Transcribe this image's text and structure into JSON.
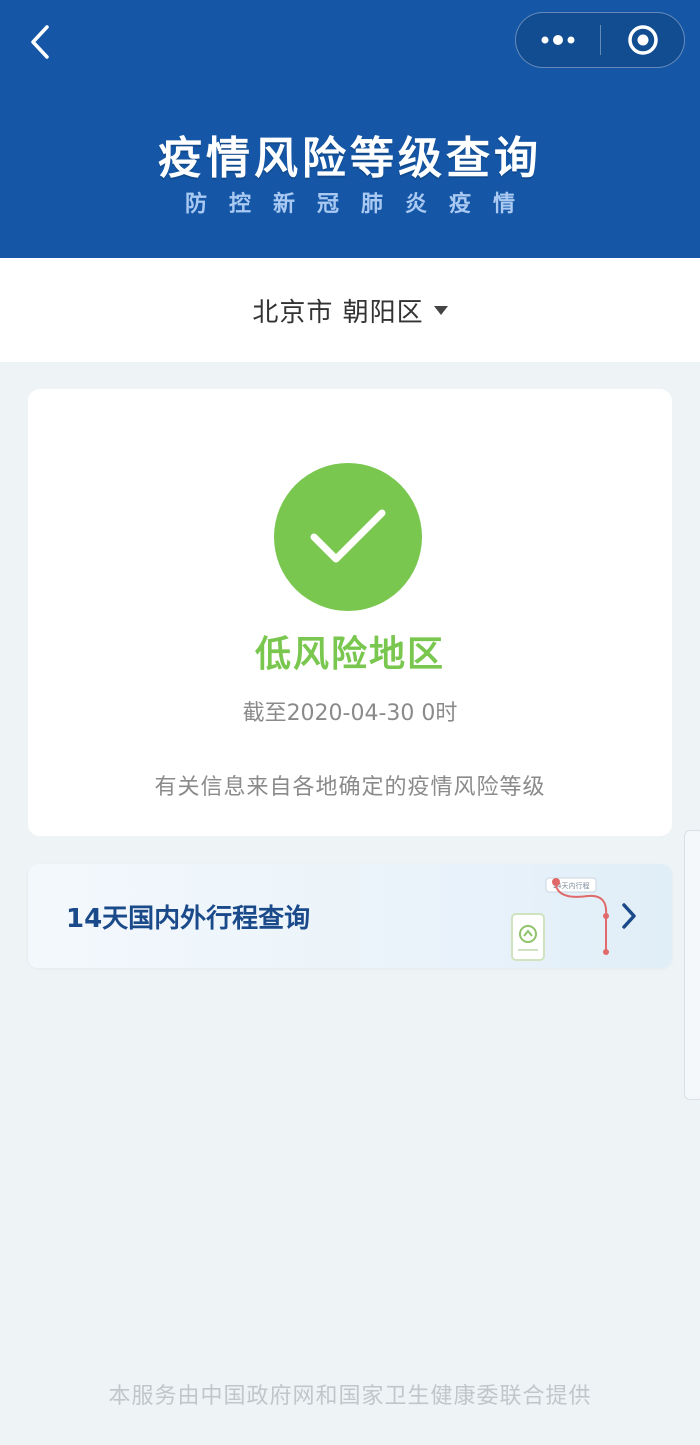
{
  "header": {
    "title": "疫情风险等级查询",
    "subtitle": "防控新冠肺炎疫情",
    "back_icon": "chevron-left-icon",
    "more_icon": "more-dots-icon",
    "close_icon": "target-circle-icon"
  },
  "location": {
    "label": "北京市 朝阳区",
    "dropdown_icon": "caret-down-icon"
  },
  "risk": {
    "icon": "checkmark-icon",
    "level": "低风险地区",
    "as_of": "截至2020-04-30 0时",
    "note": "有关信息来自各地确定的疫情风险等级",
    "color": "#7ac74f"
  },
  "trip": {
    "label": "14天国内外行程查询",
    "illustration_caption": "14天内行程",
    "arrow_icon": "chevron-right-icon"
  },
  "footer": {
    "text": "本服务由中国政府网和国家卫生健康委联合提供"
  },
  "colors": {
    "header_bg": "#1557a6",
    "page_bg": "#eef3f6",
    "accent_green": "#7ac74f",
    "link_blue": "#1b4a8a"
  }
}
